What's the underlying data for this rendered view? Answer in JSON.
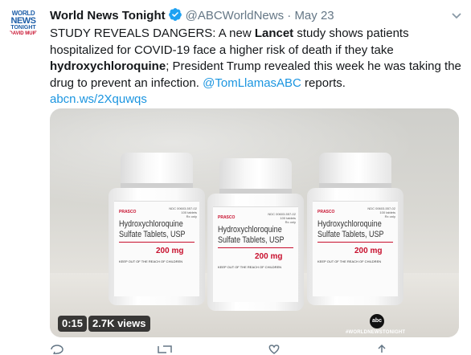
{
  "account": {
    "name": "World News Tonight",
    "handle": "@ABCWorldNews",
    "separator": "·",
    "date": "May 23",
    "avatar_text": [
      "WORLD",
      "NEWS",
      "TONIGHT",
      "DAVID MUIR"
    ]
  },
  "tweet": {
    "t1": "STUDY REVEALS DANGERS: A new ",
    "b1": "Lancet",
    "t2": " study shows patients hospitalized for COVID-19 face a higher risk of death if they take ",
    "b2": "hydroxychloroquine",
    "t3": "; President Trump revealed this week he was taking the drug to prevent an infection. ",
    "mention": "@TomLlamasABC",
    "t4": " reports.",
    "link": "abcn.ws/2Xquwqs"
  },
  "media": {
    "bottle_ndc": "NDC 00603-557-02\n100 tablets\nRx only",
    "bottle_brand": "PRASCO",
    "bottle_name_1": "Hydroxychloroquine",
    "bottle_name_2": "Sulfate Tablets, USP",
    "bottle_dose": "200 mg",
    "bottle_warning": "KEEP OUT OF THE REACH OF CHILDREN",
    "logo": "abc",
    "watermark": "#WORLDNEWSTONIGHT",
    "duration": "0:15",
    "views": "2.7K views"
  },
  "colors": {
    "link": "#1b95e0",
    "muted": "#657786",
    "verified": "#1da1f2"
  }
}
